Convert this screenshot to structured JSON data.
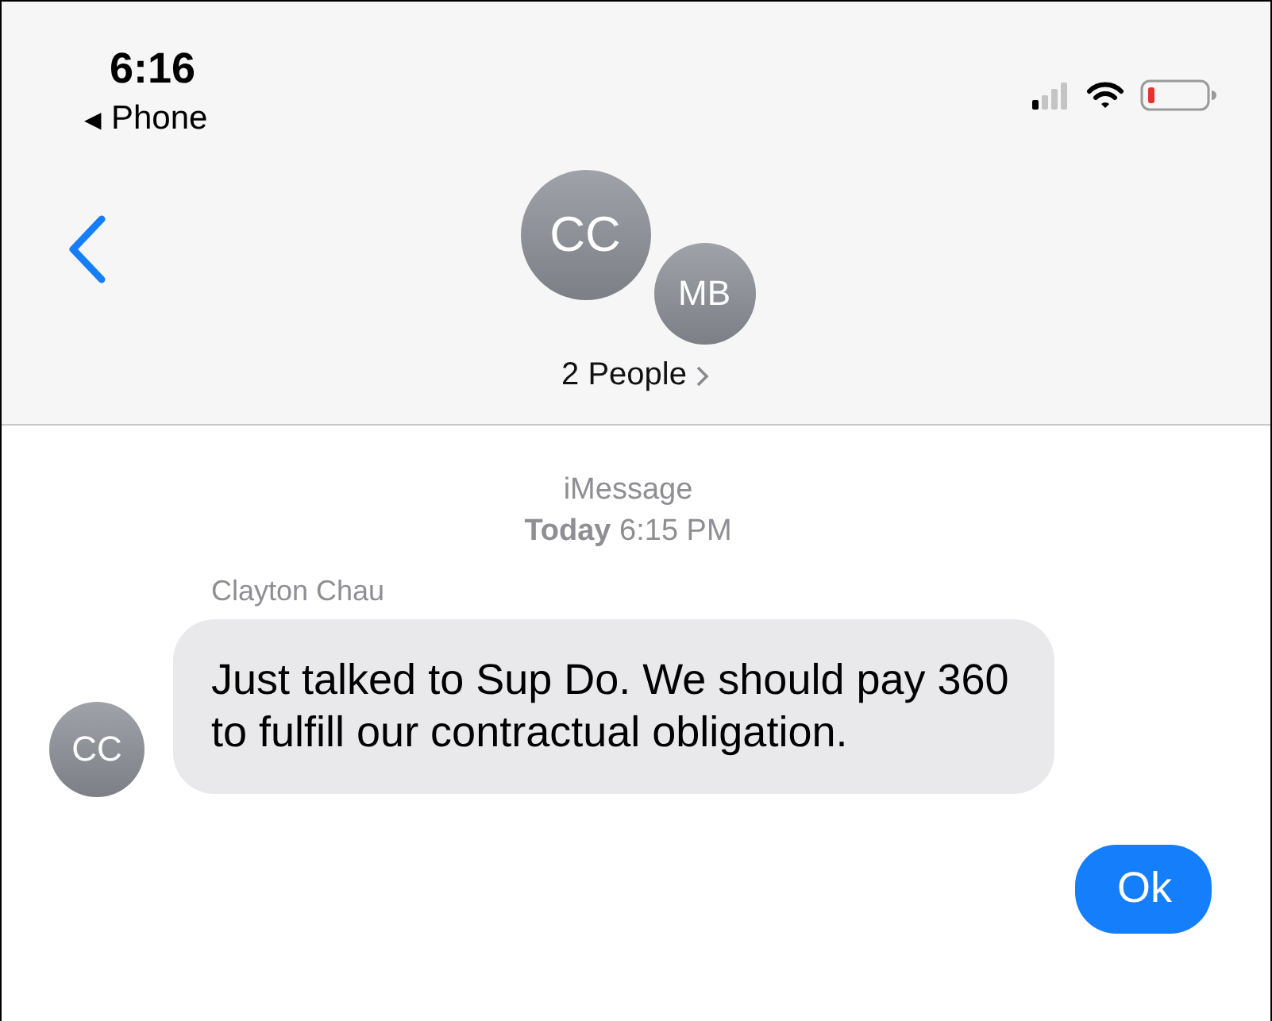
{
  "status_bar": {
    "time": "6:16",
    "back_app": {
      "arrow": "◀",
      "label": "Phone"
    }
  },
  "header": {
    "avatars": [
      {
        "initials": "CC"
      },
      {
        "initials": "MB"
      }
    ],
    "title": "2 People"
  },
  "thread": {
    "service": "iMessage",
    "timestamp": "**Today** 6:15 PM",
    "messages": [
      {
        "kind": "incoming",
        "sender": "Clayton Chau",
        "avatar": "CC",
        "text": "Just talked to Sup Do. We should pay 360 to fulfill our contractual obligation."
      },
      {
        "kind": "outgoing",
        "text": "Ok"
      }
    ]
  }
}
